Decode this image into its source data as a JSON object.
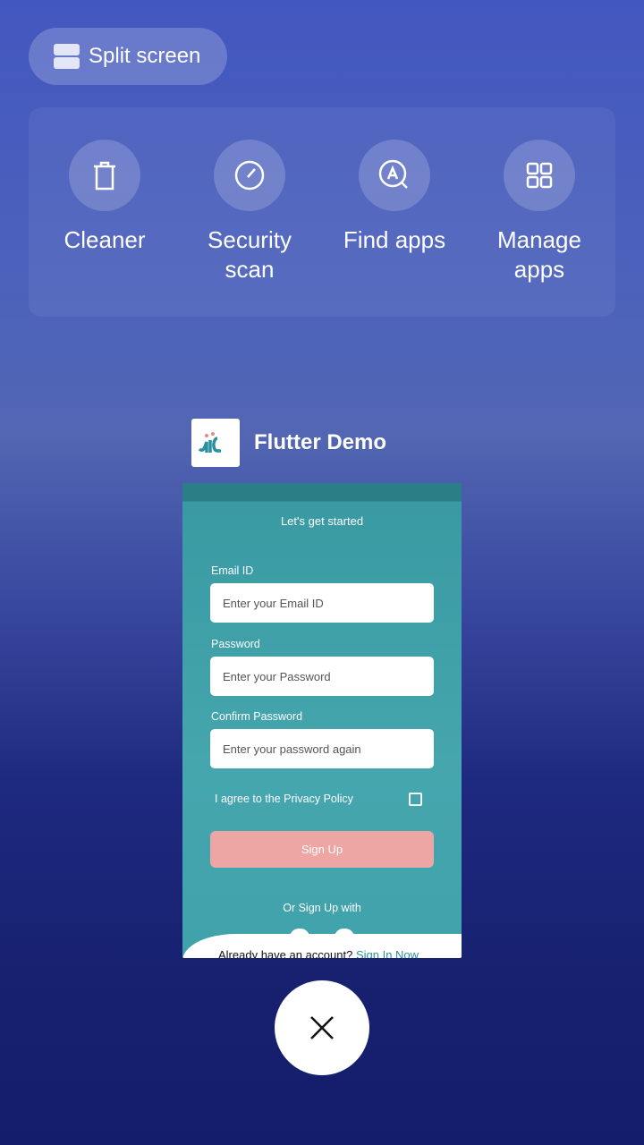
{
  "split_screen": {
    "label": "Split screen",
    "icon": "split-screen-icon"
  },
  "tools": [
    {
      "label": "Cleaner",
      "icon": "trash-icon"
    },
    {
      "label": "Security scan",
      "icon": "gauge-icon"
    },
    {
      "label": "Find apps",
      "icon": "app-search-icon"
    },
    {
      "label": "Manage apps",
      "icon": "grid-icon"
    }
  ],
  "app": {
    "title": "Flutter Demo",
    "preview": {
      "heading": "Let's get started",
      "email_label": "Email ID",
      "email_placeholder": "Enter your Email ID",
      "password_label": "Password",
      "password_placeholder": "Enter your Password",
      "confirm_label": "Confirm Password",
      "confirm_placeholder": "Enter your password again",
      "agree": "I agree to the Privacy Policy",
      "signup": "Sign Up",
      "or_with": "Or Sign Up with",
      "have_account": "Already have an account?",
      "sign_in": "Sign In Now"
    }
  },
  "colors": {
    "signup_button": "#eda6a3",
    "accent": "#2a8fa0"
  }
}
